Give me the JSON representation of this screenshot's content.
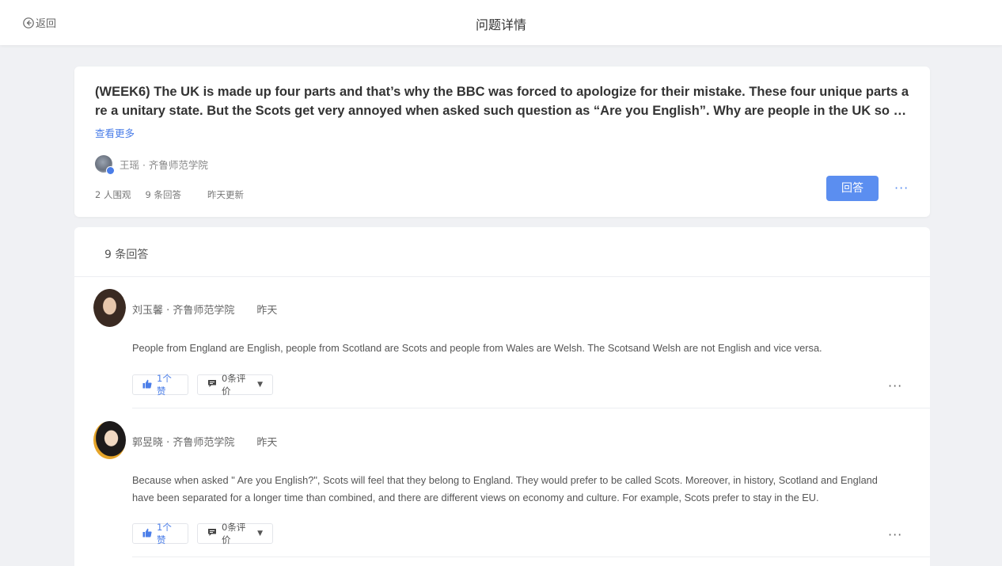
{
  "header": {
    "back_label": "返回",
    "title": "问题详情"
  },
  "question": {
    "title": "(WEEK6) The UK is made up four parts and that’s why the BBC was forced to apologize for their mistake. These four unique parts are a unitary state. But the Scots get very annoyed when asked such question as “Are you English”. Why are people in the UK so sensitive to it? Are there any historical reasons?",
    "see_more": "查看更多",
    "author": "王瑶 · 齐鲁师范学院",
    "followers": "2 人围观",
    "answers_count": "9 条回答",
    "updated": "昨天更新",
    "answer_button": "回答",
    "more": "···"
  },
  "answers_header": "9 条回答",
  "answers": [
    {
      "author": "刘玉馨 · 齐鲁师范学院",
      "time": "昨天",
      "text": "People from England are English, people from Scotland are Scots and people from Wales are Welsh. The Scotsand Welsh are not English and vice versa.",
      "likes": "1个赞",
      "comments": "0条评价",
      "more": "···"
    },
    {
      "author": "郭昱晓 · 齐鲁师范学院",
      "time": "昨天",
      "text": "Because when asked \" Are you English?\", Scots will feel that they belong to England. They would prefer to be called Scots. Moreover, in history, Scotland and England have been separated for a longer time than combined, and there are different views on economy and culture. For example, Scots prefer to stay in the EU.",
      "likes": "1个赞",
      "comments": "0条评价",
      "more": "···"
    }
  ],
  "colors": {
    "accent": "#5b8ef0",
    "link": "#4a7de8",
    "background": "#f0f1f4"
  }
}
